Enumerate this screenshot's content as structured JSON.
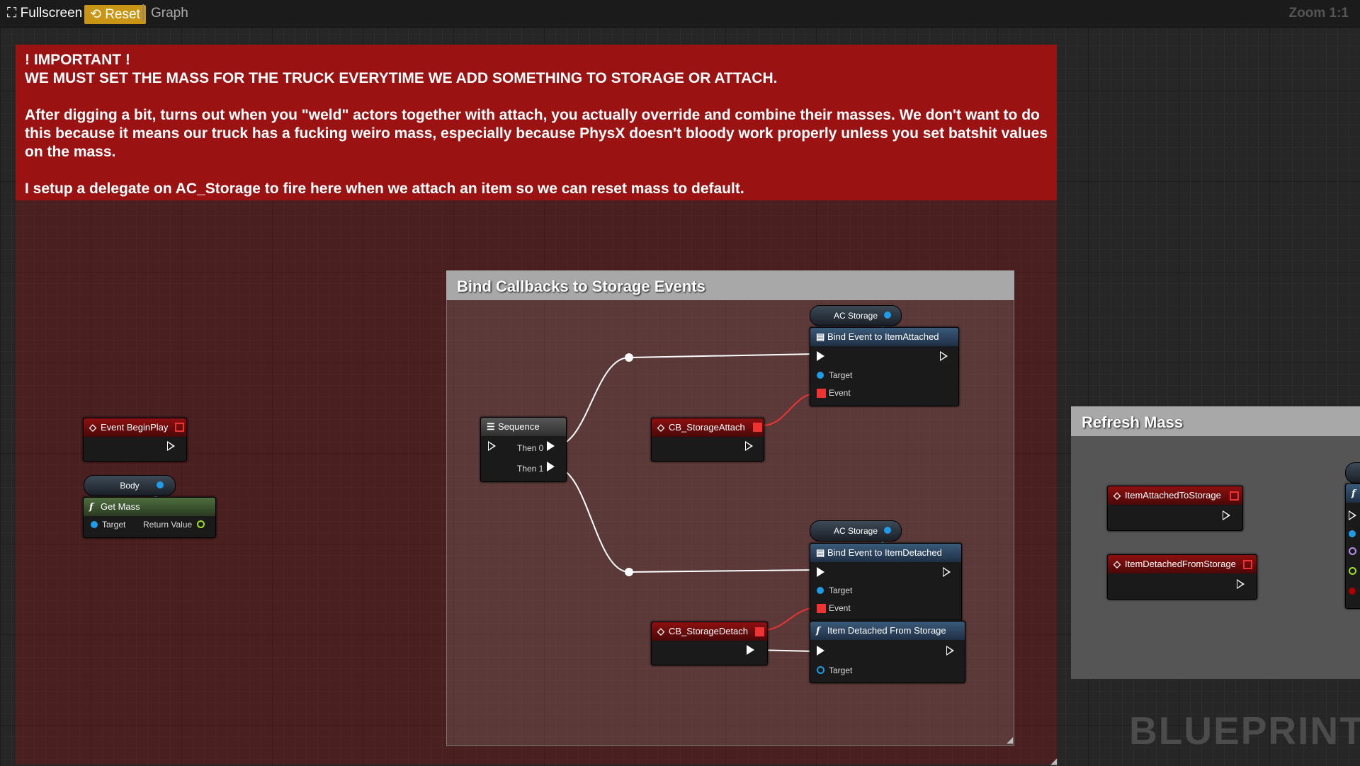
{
  "toolbar": {
    "fullscreen_label": "Fullscreen",
    "reset_label": "Reset",
    "graph_label": "Graph",
    "zoom_label": "Zoom 1:1"
  },
  "comments": {
    "important_text": "! IMPORTANT !\nWE MUST SET THE MASS FOR THE TRUCK EVERYTIME WE ADD SOMETHING TO STORAGE OR ATTACH.\n\nAfter digging a bit, turns out when you \"weld\" actors together with attach, you actually override and combine their masses. We don't want to do this because it means our truck has a fucking weiro mass, especially because PhysX doesn't bloody work properly unless you set batshit values on the mass.\n\nI setup a delegate on AC_Storage to fire here when we attach an item so we can reset mass to default.",
    "bind_title": "Bind Callbacks to Storage Events",
    "refresh_title": "Refresh Mass"
  },
  "nodes": {
    "begin_play": {
      "title": "Event BeginPlay"
    },
    "body_var": {
      "label": "Body"
    },
    "get_mass": {
      "title": "Get Mass",
      "target": "Target",
      "return_value": "Return Value"
    },
    "sequence": {
      "title": "Sequence",
      "then0": "Then 0",
      "then1": "Then 1"
    },
    "cb_attach": {
      "title": "CB_StorageAttach"
    },
    "cb_detach": {
      "title": "CB_StorageDetach"
    },
    "ac_storage_1": {
      "label": "AC Storage"
    },
    "ac_storage_2": {
      "label": "AC Storage"
    },
    "bind_attached": {
      "title": "Bind Event to ItemAttached",
      "target": "Target",
      "event": "Event"
    },
    "bind_detached": {
      "title": "Bind Event to ItemDetached",
      "target": "Target",
      "event": "Event"
    },
    "item_detached_fn": {
      "title": "Item Detached From Storage",
      "target": "Target"
    },
    "item_attached_event": {
      "title": "ItemAttachedToStorage"
    },
    "item_detached_event": {
      "title": "ItemDetachedFromStorage"
    }
  },
  "watermark": "BLUEPRINT",
  "colors": {
    "exec": "#ffffff",
    "object_pin": "#1e9ce8",
    "delegate_pin": "#e33333",
    "float_pin": "#9ce21e",
    "accent_reset": "#c89614"
  }
}
